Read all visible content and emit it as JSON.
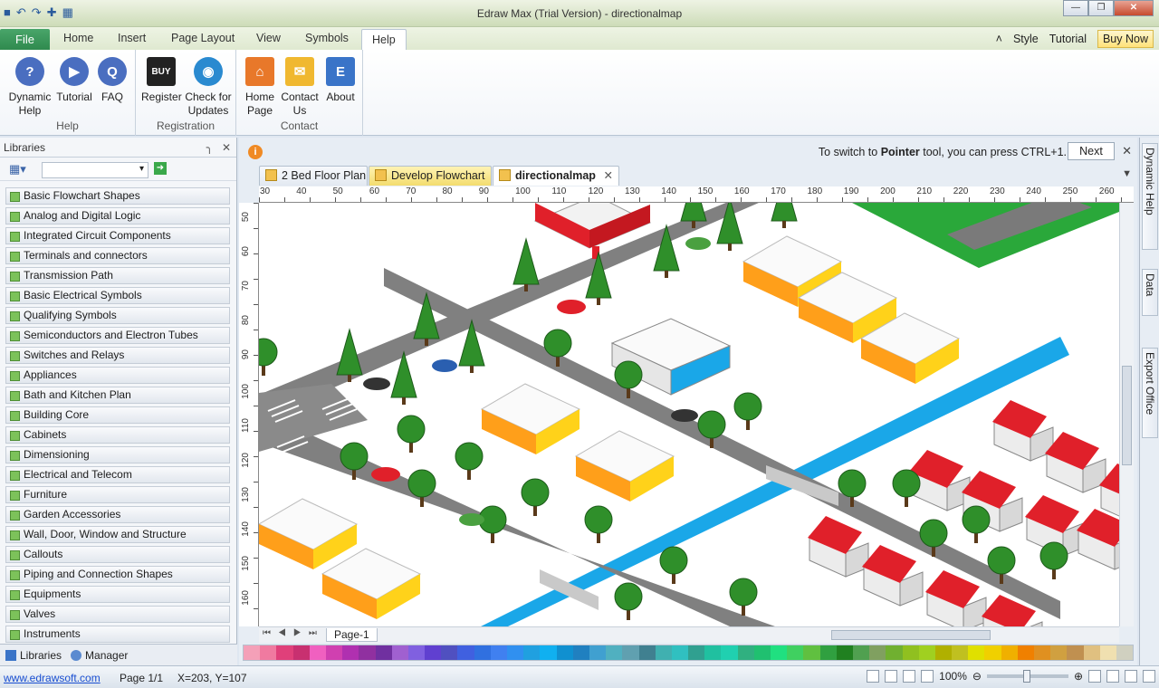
{
  "titlebar": {
    "title": "Edraw Max (Trial Version) - directionalmap",
    "controls": [
      "minimize",
      "maximize",
      "close"
    ]
  },
  "ribbon_tabs": {
    "file": "File",
    "home": "Home",
    "insert": "Insert",
    "page_layout": "Page Layout",
    "view": "View",
    "symbols": "Symbols",
    "help": "Help",
    "style": "Style",
    "tutorial": "Tutorial",
    "buy_now": "Buy Now"
  },
  "ribbon": {
    "help_group": {
      "label": "Help",
      "dynamic_help": "Dynamic Help",
      "tutorial": "Tutorial",
      "faq": "FAQ"
    },
    "registration_group": {
      "label": "Registration",
      "register": "Register",
      "check_updates": "Check for Updates"
    },
    "contact_group": {
      "label": "Contact",
      "home_page": "Home Page",
      "contact_us": "Contact Us",
      "about": "About"
    }
  },
  "libraries": {
    "title": "Libraries",
    "items": [
      "Basic Flowchart Shapes",
      "Analog and Digital Logic",
      "Integrated Circuit Components",
      "Terminals and connectors",
      "Transmission Path",
      "Basic Electrical Symbols",
      "Qualifying Symbols",
      "Semiconductors and Electron Tubes",
      "Switches and Relays",
      "Appliances",
      "Bath and Kitchen Plan",
      "Building Core",
      "Cabinets",
      "Dimensioning",
      "Electrical and Telecom",
      "Furniture",
      "Garden Accessories",
      "Wall, Door, Window and Structure",
      "Callouts",
      "Piping and Connection Shapes",
      "Equipments",
      "Valves",
      "Instruments"
    ],
    "tab_libraries": "Libraries",
    "tab_manager": "Manager"
  },
  "infobar": {
    "text_pre": "To switch to ",
    "text_bold": "Pointer",
    "text_post": " tool, you can press CTRL+1.",
    "next": "Next"
  },
  "doc_tabs": {
    "tab1": "2 Bed Floor Plan",
    "tab2": "Develop Flowchart",
    "tab3": "directionalmap"
  },
  "ruler": {
    "h": [
      "30",
      "40",
      "50",
      "60",
      "70",
      "80",
      "90",
      "100",
      "110",
      "120",
      "130",
      "140",
      "150",
      "160",
      "170",
      "180",
      "190",
      "200",
      "210",
      "220",
      "230",
      "240",
      "250",
      "260"
    ],
    "v": [
      "50",
      "60",
      "70",
      "80",
      "90",
      "100",
      "110",
      "120",
      "130",
      "140",
      "150",
      "160"
    ]
  },
  "page_tab": "Page-1",
  "right_panel": {
    "dynamic_help": "Dynamic Help",
    "data": "Data",
    "export_office": "Export Office"
  },
  "status": {
    "website": "www.edrawsoft.com",
    "page": "Page 1/1",
    "coords": "X=203, Y=107",
    "zoom": "100%"
  },
  "colors": {
    "road": "#808080",
    "river": "#1aa7e8",
    "grass": "#2aa83a",
    "tree": "#2f8f2a",
    "roof": "#e0202a",
    "building_top": "#fafafa",
    "building_side": "#ffb300"
  },
  "palette": [
    "#f4a0b8",
    "#f07aa0",
    "#e0407a",
    "#c83070",
    "#f060c0",
    "#d040b0",
    "#b030b0",
    "#9030a0",
    "#7030a0",
    "#a060d0",
    "#8060e0",
    "#6040d0",
    "#5050c0",
    "#4060e0",
    "#3070e0",
    "#4080f0",
    "#3090f0",
    "#20a0e0",
    "#10b0f0",
    "#1090d0",
    "#2080c0",
    "#40a0d0",
    "#50b0c0",
    "#60a0b0",
    "#408090",
    "#40b0b0",
    "#30c0c0",
    "#30a090",
    "#20c0a0",
    "#20d0b0",
    "#30b080",
    "#20c070",
    "#20e080",
    "#40d060",
    "#60c040",
    "#30a040",
    "#208020",
    "#50a050",
    "#80a060",
    "#70b030",
    "#90c020",
    "#a0d020",
    "#b0b000",
    "#c0c020",
    "#e0e000",
    "#f0d000",
    "#f0b000",
    "#f08000",
    "#e09020",
    "#d0a040",
    "#c09050",
    "#e0c080",
    "#f0e0b0",
    "#d0d0c0"
  ]
}
